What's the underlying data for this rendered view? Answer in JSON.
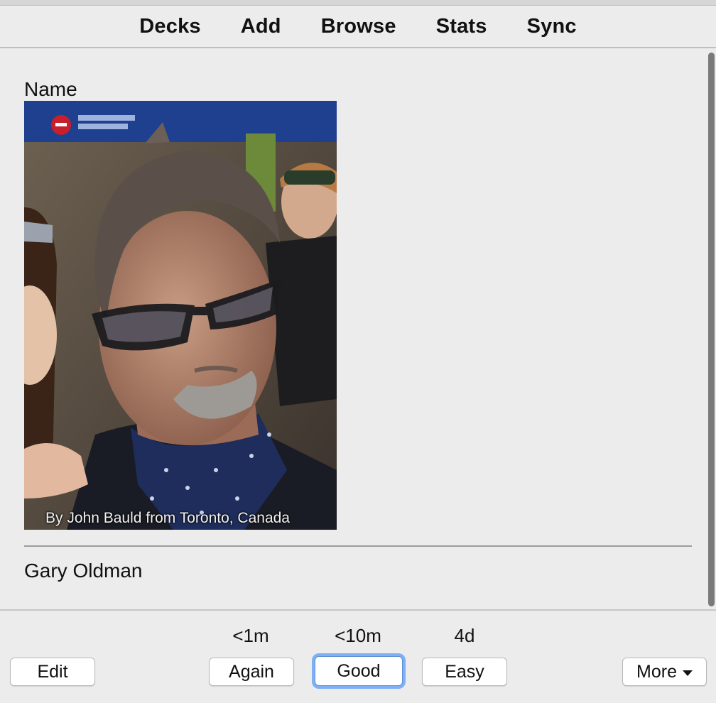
{
  "toolbar": {
    "items": [
      "Decks",
      "Add",
      "Browse",
      "Stats",
      "Sync"
    ]
  },
  "card": {
    "field_name": "Name",
    "photo_caption": "By John Bauld from Toronto, Canada",
    "answer": "Gary Oldman"
  },
  "bottom": {
    "edit_label": "Edit",
    "more_label": "More",
    "answers": [
      {
        "label": "Again",
        "interval": "<1m"
      },
      {
        "label": "Good",
        "interval": "<10m"
      },
      {
        "label": "Easy",
        "interval": "4d"
      }
    ]
  },
  "colors": {
    "background": "#ececec",
    "focus_ring": "#7fb0f5"
  }
}
